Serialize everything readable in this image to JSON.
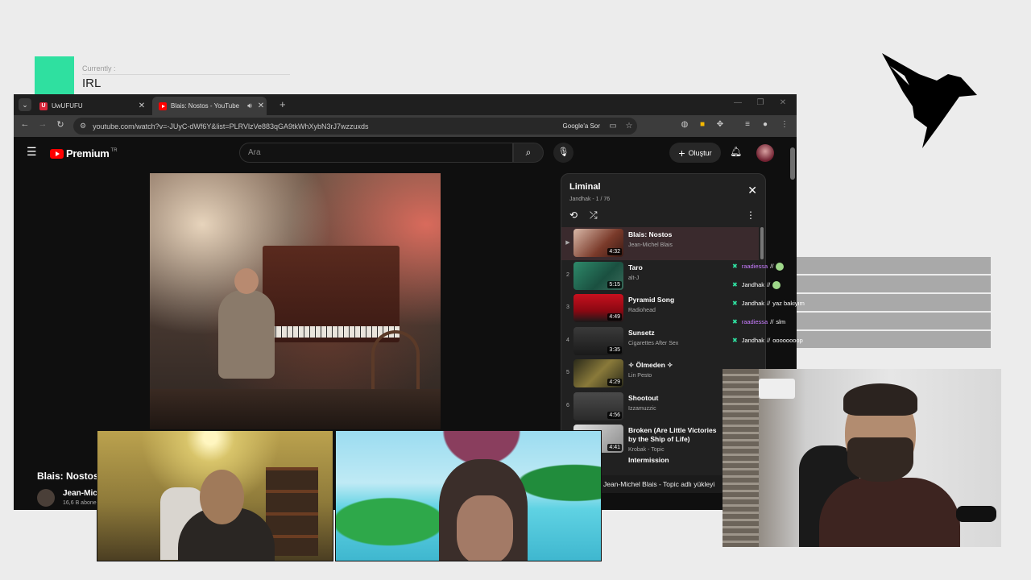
{
  "overlay": {
    "status_label": "Currently :",
    "status_value": "IRL",
    "accent_color": "#2fe0a0"
  },
  "browser": {
    "tabs": [
      {
        "title": "UwUFUFU",
        "favicon": "u-logo-icon"
      },
      {
        "title": "Blais: Nostos - YouTube",
        "favicon": "youtube-icon",
        "active": true
      }
    ],
    "url": "youtube.com/watch?v=-JUyC-dWf6Y&list=PLRVlzVe883qGA9tkWhXybN3rJ7wzzuxds",
    "google_lens_label": "Google'a Sor"
  },
  "youtube": {
    "brand": "Premium",
    "country": "TR",
    "search_placeholder": "Ara",
    "create_label": "Oluştur",
    "video_title": "Blais: Nostos",
    "channel_name": "Jean-Mic",
    "channel_subs": "16,6 B abone"
  },
  "playlist": {
    "title": "Liminal",
    "subtitle": "Jandhak - 1 / 76",
    "items": [
      {
        "index": "▶",
        "title": "Blais: Nostos",
        "artist": "Jean-Michel Blais",
        "duration": "4:32",
        "active": true
      },
      {
        "index": "2",
        "title": "Taro",
        "artist": "alt-J",
        "duration": "5:15"
      },
      {
        "index": "3",
        "title": "Pyramid Song",
        "artist": "Radiohead",
        "duration": "4:49"
      },
      {
        "index": "4",
        "title": "Sunsetz",
        "artist": "Cigarettes After Sex",
        "duration": "3:35"
      },
      {
        "index": "5",
        "title": "✧ Ölmeden ✧",
        "artist": "Lin Pesto",
        "duration": "4:29"
      },
      {
        "index": "6",
        "title": "Shootout",
        "artist": "Izzamuzzic",
        "duration": "4:56"
      },
      {
        "index": "7",
        "title": "Broken (Are Little Victories by the Ship of Life)",
        "artist": "Krobak - Topic",
        "duration": "4:41"
      }
    ],
    "partial_item": "Intermission"
  },
  "chat": [
    {
      "user": "raadiessa",
      "msg": "",
      "user_color": "#c87cff"
    },
    {
      "user": "Jandhak",
      "msg": "",
      "user_color": "#ffffff"
    },
    {
      "user": "Jandhak",
      "msg": "yaz bakiyım",
      "user_color": "#ffffff"
    },
    {
      "user": "raadiessa",
      "msg": "slm",
      "user_color": "#c87cff"
    },
    {
      "user": "Jandhak",
      "msg": "oooooooop",
      "user_color": "#ffffff"
    }
  ],
  "notification": "Jean-Michel Blais - Topic adlı yükleyi"
}
